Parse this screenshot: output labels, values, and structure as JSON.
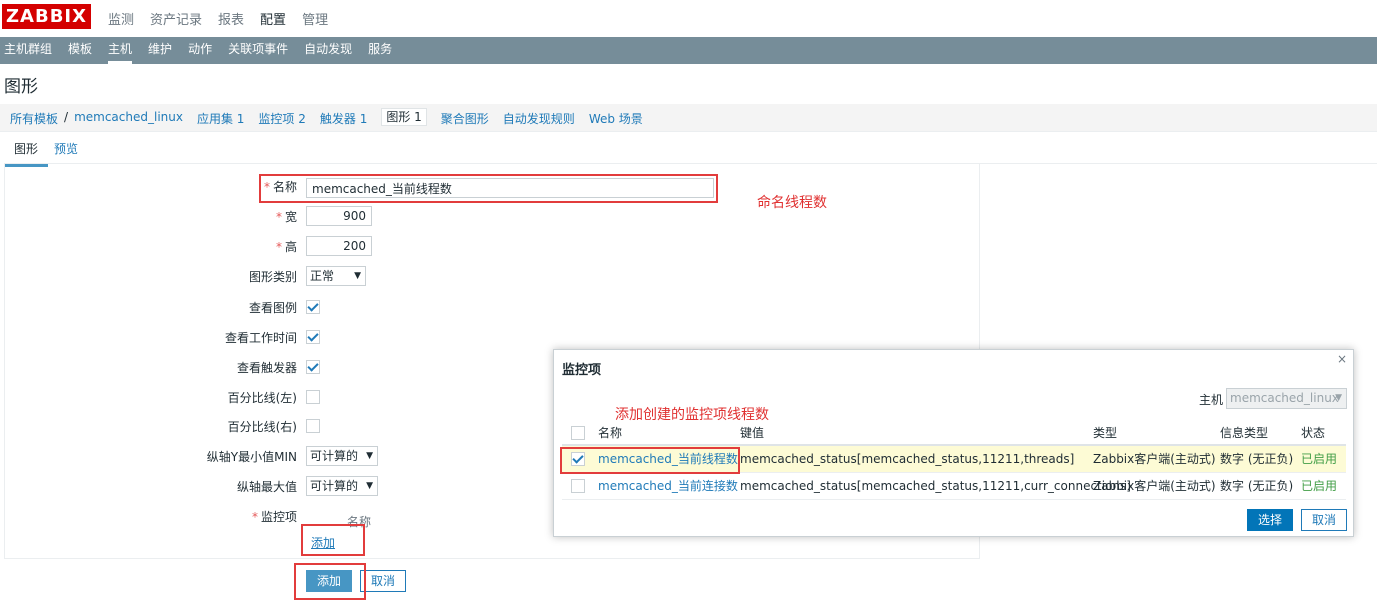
{
  "brand": {
    "logo": "ZABBIX",
    "color": "#d40000"
  },
  "top_menu": [
    "监测",
    "资产记录",
    "报表",
    "配置",
    "管理"
  ],
  "top_menu_active": "配置",
  "sub_nav": [
    "主机群组",
    "模板",
    "主机",
    "维护",
    "动作",
    "关联项事件",
    "自动发现",
    "服务"
  ],
  "sub_nav_active": "主机",
  "page_title": "图形",
  "breadcrumbs": {
    "all_templates": "所有模板",
    "separator": "/",
    "template": "memcached_linux",
    "apps": "应用集 1",
    "items": "监控项 2",
    "triggers": "触发器 1",
    "graphs": "图形 1",
    "screens": "聚合图形",
    "discovery": "自动发现规则",
    "web": "Web 场景"
  },
  "form_tabs": [
    "图形",
    "预览"
  ],
  "form": {
    "required_mark": "*",
    "name_label": "名称",
    "name_value": "memcached_当前线程数",
    "width_label": "宽",
    "width_value": "900",
    "height_label": "高",
    "height_value": "200",
    "graph_type_label": "图形类别",
    "graph_type_value": "正常",
    "show_legend_label": "查看图例",
    "show_work_period_label": "查看工作时间",
    "show_triggers_label": "查看触发器",
    "percentile_left_label": "百分比线(左)",
    "percentile_right_label": "百分比线(右)",
    "ymin_label": "纵轴Y最小值MIN",
    "ymin_value": "可计算的",
    "ymax_label": "纵轴最大值",
    "ymax_value": "可计算的",
    "items_label": "监控项",
    "items_col_name": "名称",
    "add_link": "添加",
    "submit_button": "添加",
    "cancel_button": "取消"
  },
  "annotations": {
    "name": "命名线程数",
    "items": "添加创建的监控项线程数",
    "color": "#e03131"
  },
  "popup": {
    "title": "监控项",
    "close": "×",
    "host_label": "主机",
    "host_value": "memcached_linux",
    "columns": {
      "name": "名称",
      "key": "键值",
      "type": "类型",
      "info_type": "信息类型",
      "status": "状态"
    },
    "rows": [
      {
        "name": "memcached_当前线程数",
        "key": "memcached_status[memcached_status,11211,threads]",
        "type": "Zabbix客户端(主动式)",
        "info_type": "数字 (无正负)",
        "status": "已启用",
        "checked": true
      },
      {
        "name": "memcached_当前连接数",
        "key": "memcached_status[memcached_status,11211,curr_connections]",
        "type": "Zabbix客户端(主动式)",
        "info_type": "数字 (无正负)",
        "status": "已启用",
        "checked": false
      }
    ],
    "select_button": "选择",
    "cancel_button": "取消"
  }
}
